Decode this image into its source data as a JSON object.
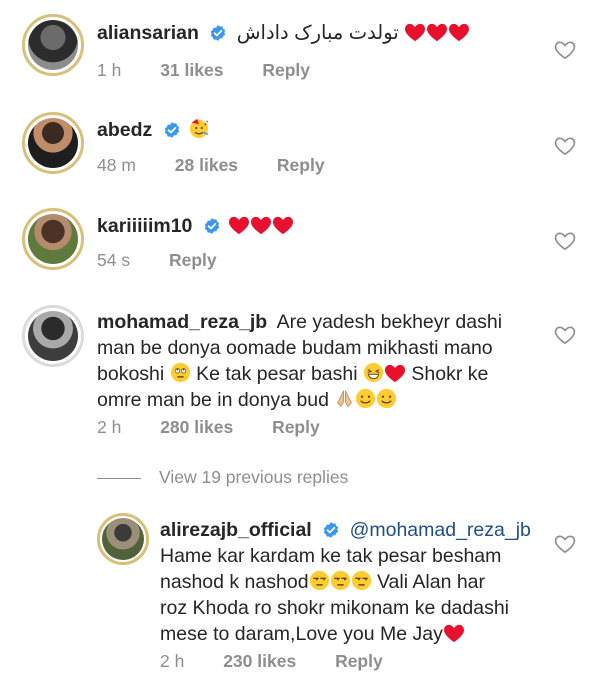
{
  "comments": [
    {
      "username": "aliansarian",
      "text": "تولدت مبارک داداش",
      "time": "1 h",
      "likes": "31 likes",
      "reply": "Reply"
    },
    {
      "username": "abedz",
      "text": "",
      "time": "48 m",
      "likes": "28 likes",
      "reply": "Reply"
    },
    {
      "username": "kariiiiim10",
      "text": "",
      "time": "54 s",
      "likes": "",
      "reply": "Reply"
    },
    {
      "username": "mohamad_reza_jb",
      "line1": "Are yadesh bekheyr dashi",
      "line2": "man be donya oomade budam mikhasti mano",
      "line3a": "bokoshi",
      "line3b": "Ke tak pesar bashi",
      "line3c": "Shokr ke",
      "line4": "omre man be in donya bud",
      "time": "2 h",
      "likes": "280 likes",
      "reply": "Reply"
    }
  ],
  "view_replies": "View 19 previous replies",
  "reply_comment": {
    "username": "alirezajb_official",
    "mention": "@mohamad_reza_jb",
    "line1": "Hame kar kardam ke tak pesar besham",
    "line2": "nashod k nashod",
    "line3": "Vali Alan har",
    "line4": "roz Khoda ro shokr mikonam ke dadashi",
    "line5": "mese to daram,Love you Me Jay",
    "time": "2 h",
    "likes": "230 likes",
    "reply": "Reply"
  },
  "icons": {
    "verified": "verified-badge-icon",
    "like": "heart-outline-icon",
    "heart_emoji": "red-heart-emoji",
    "party_emoji": "party-face-emoji"
  },
  "colors": {
    "verified_blue": "#3897f0",
    "heart_red": "#e8112d",
    "meta_gray": "#8e8e8e",
    "mention_blue": "#1f4e8c"
  }
}
